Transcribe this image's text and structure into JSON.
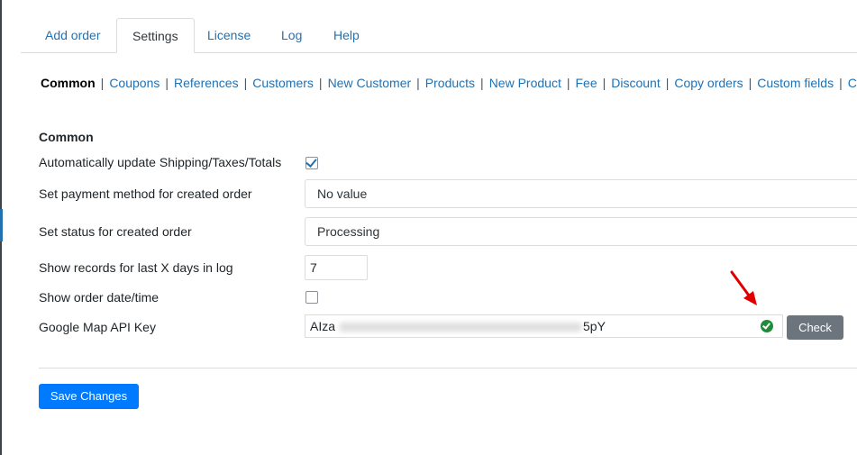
{
  "tabs": [
    {
      "label": "Add order"
    },
    {
      "label": "Settings",
      "active": true
    },
    {
      "label": "License"
    },
    {
      "label": "Log"
    },
    {
      "label": "Help"
    }
  ],
  "subnav": {
    "current": "Common",
    "items": [
      "Coupons",
      "References",
      "Customers",
      "New Customer",
      "Products",
      "New Product",
      "Fee",
      "Discount",
      "Copy orders",
      "Custom fields",
      "Ch"
    ]
  },
  "section": {
    "title": "Common"
  },
  "fields": {
    "auto_update": {
      "label": "Automatically update Shipping/Taxes/Totals",
      "checked": true
    },
    "payment_method": {
      "label": "Set payment method for created order",
      "value": "No value"
    },
    "status": {
      "label": "Set status for created order",
      "value": "Processing"
    },
    "log_days": {
      "label": "Show records for last X days in log",
      "value": "7"
    },
    "order_datetime": {
      "label": "Show order date/time",
      "checked": false
    },
    "map_key": {
      "label": "Google Map API Key",
      "value_start": "AIza",
      "value_end": "5pY",
      "status_icon": "check-circle-icon"
    }
  },
  "buttons": {
    "check": "Check",
    "save": "Save Changes"
  },
  "colors": {
    "link": "#2271b1",
    "primary_button": "#007bff",
    "secondary_button": "#6c757d",
    "ok": "#1e8c3a",
    "annotation_arrow": "#e00000"
  }
}
